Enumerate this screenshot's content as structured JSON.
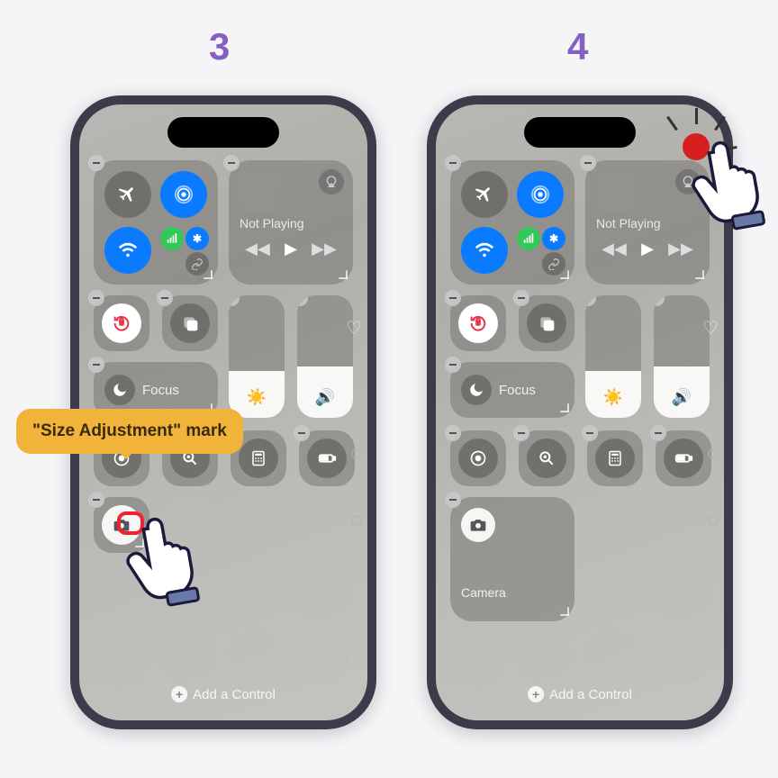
{
  "steps": {
    "left": "3",
    "right": "4"
  },
  "callout": {
    "text": "\"Size Adjustment\" mark"
  },
  "media": {
    "not_playing": "Not Playing"
  },
  "focus": {
    "label": "Focus"
  },
  "camera": {
    "label": "Camera"
  },
  "add_control": {
    "label": "Add a Control"
  },
  "icons": {
    "airplane": "airplane-icon",
    "airdrop": "airdrop-icon",
    "wifi": "wifi-icon",
    "cellular": "cellular-icon",
    "bluetooth": "bluetooth-icon",
    "link": "link-icon",
    "airplay": "airplay-icon",
    "rotation_lock": "rotation-lock-icon",
    "screen_mirroring": "screen-mirroring-icon",
    "moon": "moon-icon",
    "sun": "sun-icon",
    "volume": "volume-icon",
    "record": "record-icon",
    "magnifier": "magnifier-icon",
    "calculator": "calculator-icon",
    "battery": "battery-icon",
    "camera": "camera-icon",
    "heart": "heart-icon"
  },
  "colors": {
    "step_num": "#8560c2",
    "callout_bg": "#f2b33a",
    "blue": "#0a7aff",
    "green": "#34c759",
    "red": "#d62020"
  }
}
